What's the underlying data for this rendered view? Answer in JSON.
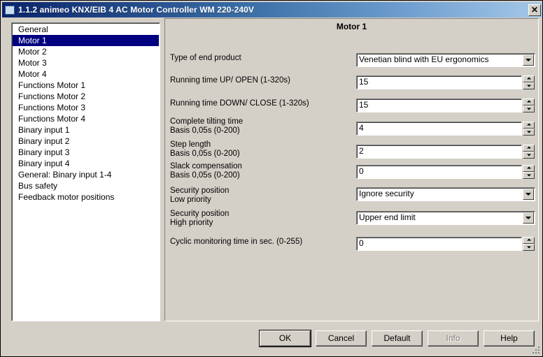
{
  "window": {
    "title": "1.1.2 animeo KNX/EIB 4 AC Motor Controller WM 220-240V",
    "close_label": "✕",
    "icon": "window-icon"
  },
  "sidebar": {
    "items": [
      {
        "label": "General",
        "selected": false
      },
      {
        "label": "Motor 1",
        "selected": true
      },
      {
        "label": "Motor 2",
        "selected": false
      },
      {
        "label": "Motor 3",
        "selected": false
      },
      {
        "label": "Motor 4",
        "selected": false
      },
      {
        "label": "Functions Motor 1",
        "selected": false
      },
      {
        "label": "Functions Motor 2",
        "selected": false
      },
      {
        "label": "Functions Motor 3",
        "selected": false
      },
      {
        "label": "Functions Motor 4",
        "selected": false
      },
      {
        "label": "Binary input 1",
        "selected": false
      },
      {
        "label": "Binary input 2",
        "selected": false
      },
      {
        "label": "Binary input 3",
        "selected": false
      },
      {
        "label": "Binary input 4",
        "selected": false
      },
      {
        "label": "General: Binary input 1-4",
        "selected": false
      },
      {
        "label": "Bus safety",
        "selected": false
      },
      {
        "label": "Feedback motor positions",
        "selected": false
      }
    ]
  },
  "panel": {
    "title": "Motor 1",
    "rows": [
      {
        "label1": "Type of end product",
        "label2": "",
        "type": "combo",
        "value": "Venetian blind  with EU ergonomics"
      },
      {
        "label1": "Running time UP/ OPEN (1-320s)",
        "label2": "",
        "type": "spin",
        "value": "15"
      },
      {
        "label1": "Running time DOWN/ CLOSE (1-320s)",
        "label2": "",
        "type": "spin",
        "value": "15"
      },
      {
        "label1": "Complete tilting time",
        "label2": "Basis 0,05s (0-200)",
        "type": "spin",
        "value": "4"
      },
      {
        "label1": "Step length",
        "label2": "Basis 0,05s (0-200)",
        "type": "spin",
        "value": "2"
      },
      {
        "label1": "Slack compensation",
        "label2": "Basis 0,05s (0-200)",
        "type": "spin",
        "value": "0"
      },
      {
        "label1": "Security position",
        "label2": "Low priority",
        "type": "combo",
        "value": "Ignore security"
      },
      {
        "label1": "Security position",
        "label2": "High priority",
        "type": "combo",
        "value": "Upper end limit"
      },
      {
        "label1": "Cyclic monitoring time in sec. (0-255)",
        "label2": "",
        "type": "spin",
        "value": "0"
      }
    ]
  },
  "buttons": [
    {
      "label": "OK",
      "disabled": false,
      "default": true
    },
    {
      "label": "Cancel",
      "disabled": false,
      "default": false
    },
    {
      "label": "Default",
      "disabled": false,
      "default": false
    },
    {
      "label": "Info",
      "disabled": true,
      "default": false
    },
    {
      "label": "Help",
      "disabled": false,
      "default": false
    }
  ],
  "colors": {
    "window_bg": "#d4d0c8",
    "selection": "#000080",
    "titlebar_start": "#0a246a",
    "titlebar_end": "#a6c8e8"
  }
}
